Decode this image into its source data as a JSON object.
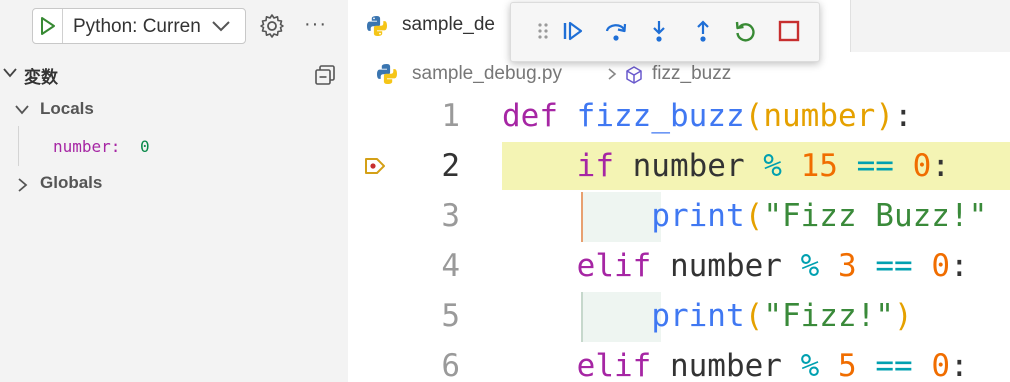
{
  "sidebar": {
    "run_config": "Python: Curren",
    "section_title": "変数",
    "tree": {
      "locals_label": "Locals",
      "globals_label": "Globals",
      "variables": [
        {
          "name": "number:",
          "value": "0"
        }
      ]
    },
    "more_label": "···"
  },
  "editor": {
    "tab_label": "sample_de",
    "breadcrumb": {
      "file": "sample_debug.py",
      "symbol": "fizz_buzz"
    },
    "current_line": 2,
    "lines": [
      {
        "num": "1",
        "tokens": [
          [
            "kw",
            "def"
          ],
          [
            "plain",
            " "
          ],
          [
            "fn",
            "fizz_buzz"
          ],
          [
            "paren",
            "("
          ],
          [
            "param",
            "number"
          ],
          [
            "paren",
            ")"
          ],
          [
            "plain",
            ":"
          ]
        ]
      },
      {
        "num": "2",
        "tokens": [
          [
            "plain",
            "    "
          ],
          [
            "kw",
            "if"
          ],
          [
            "plain",
            " number "
          ],
          [
            "op",
            "%"
          ],
          [
            "plain",
            " "
          ],
          [
            "num",
            "15"
          ],
          [
            "plain",
            " "
          ],
          [
            "op",
            "=="
          ],
          [
            "plain",
            " "
          ],
          [
            "num",
            "0"
          ],
          [
            "plain",
            ":"
          ]
        ]
      },
      {
        "num": "3",
        "tokens": [
          [
            "plain",
            "        "
          ],
          [
            "fn",
            "print"
          ],
          [
            "paren",
            "("
          ],
          [
            "str",
            "\"Fizz Buzz!\""
          ]
        ]
      },
      {
        "num": "4",
        "tokens": [
          [
            "plain",
            "    "
          ],
          [
            "kw",
            "elif"
          ],
          [
            "plain",
            " number "
          ],
          [
            "op",
            "%"
          ],
          [
            "plain",
            " "
          ],
          [
            "num",
            "3"
          ],
          [
            "plain",
            " "
          ],
          [
            "op",
            "=="
          ],
          [
            "plain",
            " "
          ],
          [
            "num",
            "0"
          ],
          [
            "plain",
            ":"
          ]
        ]
      },
      {
        "num": "5",
        "tokens": [
          [
            "plain",
            "        "
          ],
          [
            "fn",
            "print"
          ],
          [
            "paren",
            "("
          ],
          [
            "str",
            "\"Fizz!\""
          ],
          [
            "paren",
            ")"
          ]
        ]
      },
      {
        "num": "6",
        "tokens": [
          [
            "plain",
            "    "
          ],
          [
            "kw",
            "elif"
          ],
          [
            "plain",
            " number "
          ],
          [
            "op",
            "%"
          ],
          [
            "plain",
            " "
          ],
          [
            "num",
            "5"
          ],
          [
            "plain",
            " "
          ],
          [
            "op",
            "=="
          ],
          [
            "plain",
            " "
          ],
          [
            "num",
            "0"
          ],
          [
            "plain",
            ":"
          ]
        ]
      }
    ]
  },
  "debug_toolbar": {
    "buttons": [
      "drag-handle-icon",
      "continue-icon",
      "step-over-icon",
      "step-into-icon",
      "step-out-icon",
      "restart-icon",
      "stop-icon"
    ]
  },
  "colors": {
    "accent_blue": "#1f6fd6",
    "run_green": "#388a34",
    "stop_red": "#c72e2e",
    "current_line_bg": "#f4f4b4"
  }
}
